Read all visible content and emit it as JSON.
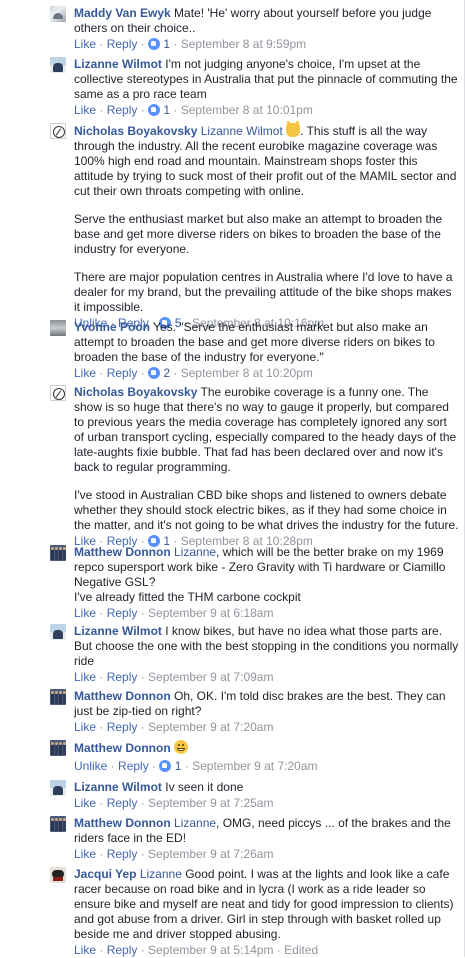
{
  "comments": [
    {
      "author": "Maddy Van Ewyk",
      "paragraphs": [
        "Mate! 'He' worry about yourself before you judge others on their choice.."
      ],
      "like_label": "Like",
      "reply_label": "Reply",
      "reactions": "1",
      "time": "September 8 at 9:59pm"
    },
    {
      "author": "Lizanne Wilmot",
      "paragraphs": [
        "I'm not judging anyone's choice, I'm upset at the collective stereotypes in Australia that put the pinnacle of commuting the same as a pro race team"
      ],
      "like_label": "Like",
      "reply_label": "Reply",
      "reactions": "1",
      "time": "September 8 at 10:01pm"
    },
    {
      "author": "Nicholas Boyakovsky",
      "tag": "Lizanne Wilmot",
      "emoji": "raised-hands-emoji",
      "paragraphs": [
        ". This stuff is all the way through the industry. All the recent eurobike magazine coverage was 100% high end road and mountain. Mainstream shops foster this attitude by trying to suck most of their profit out of the MAMIL sector and cut their own throats competing with online.",
        "Serve the enthusiast market but also make an attempt to broaden the base and get more diverse riders on bikes to broaden the base of the industry for everyone.",
        "There are major population centres in Australia where I'd love to have a dealer for my brand, but the prevailing attitude of the bike shops makes it impossible."
      ],
      "like_label": "Unlike",
      "reply_label": "Reply",
      "reactions": "5",
      "time": "September 8 at 10:16pm"
    },
    {
      "author": "Yvonne Poon",
      "paragraphs": [
        "Yes. \"Serve the enthusiast market but also make an attempt to broaden the base and get more diverse riders on bikes to broaden the base of the industry for everyone.\""
      ],
      "like_label": "Like",
      "reply_label": "Reply",
      "reactions": "2",
      "time": "September 8 at 10:20pm"
    },
    {
      "author": "Nicholas Boyakovsky",
      "paragraphs": [
        "The eurobike coverage is a funny one. The show is so huge that there's no way to gauge it properly, but compared to previous years the media coverage has completely ignored any sort of urban transport cycling, especially compared to the heady days of the late-aughts fixie bubble. That fad has been declared over and now it's back to regular programming.",
        "I've stood in Australian CBD bike shops and listened to owners debate whether they should stock electric bikes, as if they had some choice in the matter, and it's not going to be what drives the industry for the future."
      ],
      "like_label": "Like",
      "reply_label": "Reply",
      "reactions": "1",
      "time": "September 8 at 10:28pm"
    },
    {
      "author": "Matthew Donnon",
      "tag": "Lizanne",
      "paragraphs": [
        ", which will be the better brake on my 1969 repco supersport work bike - Zero Gravity with Ti hardware or Ciamillo Negative GSL?\nI've already fitted the THM carbone cockpit"
      ],
      "like_label": "Like",
      "reply_label": "Reply",
      "reactions": "",
      "time": "September 9 at 6:18am"
    },
    {
      "author": "Lizanne Wilmot",
      "paragraphs": [
        "I know bikes, but have no idea what those parts are. But choose the one with the best stopping in the conditions you normally ride"
      ],
      "like_label": "Like",
      "reply_label": "Reply",
      "reactions": "",
      "time": "September 9 at 7:09am"
    },
    {
      "author": "Matthew Donnon",
      "paragraphs": [
        "Oh, OK. I'm told disc brakes are the best. They can just be zip-tied on right?"
      ],
      "like_label": "Like",
      "reply_label": "Reply",
      "reactions": "",
      "time": "September 9 at 7:20am"
    },
    {
      "author": "Matthew Donnon",
      "emoji": "grinning-emoji",
      "paragraphs": [
        ""
      ],
      "like_label": "Unlike",
      "reply_label": "Reply",
      "reactions": "1",
      "time": "September 9 at 7:20am"
    },
    {
      "author": "Lizanne Wilmot",
      "paragraphs": [
        "Iv seen it done"
      ],
      "like_label": "Like",
      "reply_label": "Reply",
      "reactions": "",
      "time": "September 9 at 7:25am"
    },
    {
      "author": "Matthew Donnon",
      "tag": "Lizanne",
      "paragraphs": [
        ", OMG, need piccys ... of the brakes and the riders face in the ED!"
      ],
      "like_label": "Like",
      "reply_label": "Reply",
      "reactions": "",
      "time": "September 9 at 7:26am"
    },
    {
      "author": "Jacqui Yep",
      "tag": "Lizanne",
      "paragraphs": [
        " Good point. I was at the lights and look like a cafe racer because on road bike and in lycra (I work as a ride leader so ensure bike and myself are neat and tidy for good impression to clients) and got abuse from a driver. Girl in step through with basket rolled up beside me and driver stopped abusing."
      ],
      "like_label": "Like",
      "reply_label": "Reply",
      "reactions": "",
      "time": "September 9 at 5:14pm",
      "edited": "Edited"
    }
  ],
  "colors": {
    "name": "#365899",
    "link": "#4267b2",
    "meta": "#90949c",
    "like_badge": "#5890ff"
  }
}
